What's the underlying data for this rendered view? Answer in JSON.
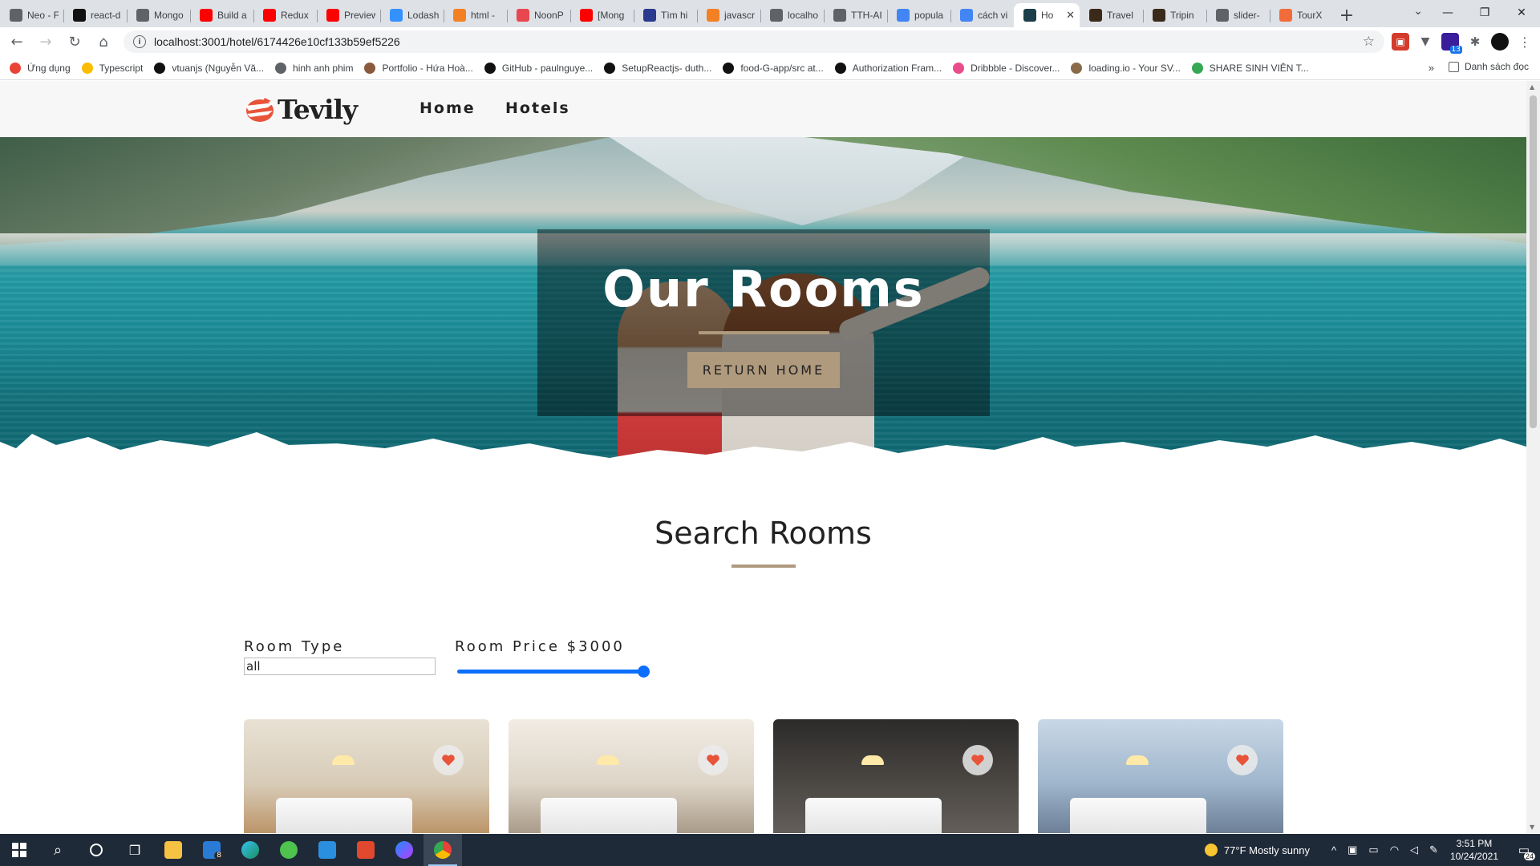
{
  "browser": {
    "tabs": [
      {
        "title": "Neo - F",
        "favicon_color": "#5f6368"
      },
      {
        "title": "react-d",
        "favicon_color": "#111111"
      },
      {
        "title": "Mongo",
        "favicon_color": "#5f6368"
      },
      {
        "title": "Build a",
        "favicon_color": "#ff0000"
      },
      {
        "title": "Redux",
        "favicon_color": "#ff0000"
      },
      {
        "title": "Preview",
        "favicon_color": "#ff0000"
      },
      {
        "title": "Lodash",
        "favicon_color": "#3492ff"
      },
      {
        "title": "html -",
        "favicon_color": "#f48024"
      },
      {
        "title": "NoonP",
        "favicon_color": "#e8474f"
      },
      {
        "title": "[Mong",
        "favicon_color": "#ff0000"
      },
      {
        "title": "Tìm hi",
        "favicon_color": "#2a3b8f"
      },
      {
        "title": "javascr",
        "favicon_color": "#f48024"
      },
      {
        "title": "localho",
        "favicon_color": "#5f6368"
      },
      {
        "title": "TTH-AI",
        "favicon_color": "#5f6368"
      },
      {
        "title": "popula",
        "favicon_color": "#4285f4"
      },
      {
        "title": "cách vi",
        "favicon_color": "#4285f4"
      },
      {
        "title": "Ho",
        "favicon_color": "#1c3d4a",
        "active": true
      },
      {
        "title": "Travel",
        "favicon_color": "#3b2a1a"
      },
      {
        "title": "Tripin",
        "favicon_color": "#3b2a1a"
      },
      {
        "title": "slider-",
        "favicon_color": "#5f6368"
      },
      {
        "title": "TourX",
        "favicon_color": "#f26b3a"
      }
    ],
    "new_tab_label": "+",
    "url": "localhost:3001/hotel/6174426e10cf133b59ef5226",
    "bookmarks": [
      {
        "label": "Ứng dụng",
        "color": "#ea4335"
      },
      {
        "label": "Typescript",
        "color": "#fbbc04"
      },
      {
        "label": "vtuanjs (Nguyễn Vă...",
        "color": "#111111"
      },
      {
        "label": "hinh anh phim",
        "color": "#5f6368"
      },
      {
        "label": "Portfolio - Hứa Hoà...",
        "color": "#8a5a3c"
      },
      {
        "label": "GitHub - paulnguye...",
        "color": "#111111"
      },
      {
        "label": "SetupReactjs- duth...",
        "color": "#111111"
      },
      {
        "label": "food-G-app/src at...",
        "color": "#111111"
      },
      {
        "label": "Authorization Fram...",
        "color": "#111111"
      },
      {
        "label": "Dribbble - Discover...",
        "color": "#ea4c89"
      },
      {
        "label": "loading.io - Your SV...",
        "color": "#8a6a4a"
      },
      {
        "label": "SHARE SINH VIÊN T...",
        "color": "#34a853"
      }
    ],
    "bookmarks_more": "»",
    "reading_list": "Danh sách đọc",
    "extension_badge": "13"
  },
  "site": {
    "logo_text": "Tevily",
    "nav": [
      "Home",
      "Hotels"
    ],
    "hero_title": "Our Rooms",
    "hero_button": "RETURN HOME",
    "section_title": "Search Rooms",
    "room_type_label": "Room Type",
    "room_type_value": "all",
    "room_price_label": "Room Price $3000",
    "room_price_fraction": 1.0,
    "accent_color": "#af9a7d",
    "room_cards": [
      {
        "name": "room-card-1",
        "favorite": true
      },
      {
        "name": "room-card-2",
        "favorite": true
      },
      {
        "name": "room-card-3",
        "favorite": true
      },
      {
        "name": "room-card-4",
        "favorite": true
      }
    ]
  },
  "taskbar": {
    "mail_badge": "8",
    "weather": "77°F  Mostly sunny",
    "time": "3:51 PM",
    "date": "10/24/2021",
    "notifications": "24"
  }
}
